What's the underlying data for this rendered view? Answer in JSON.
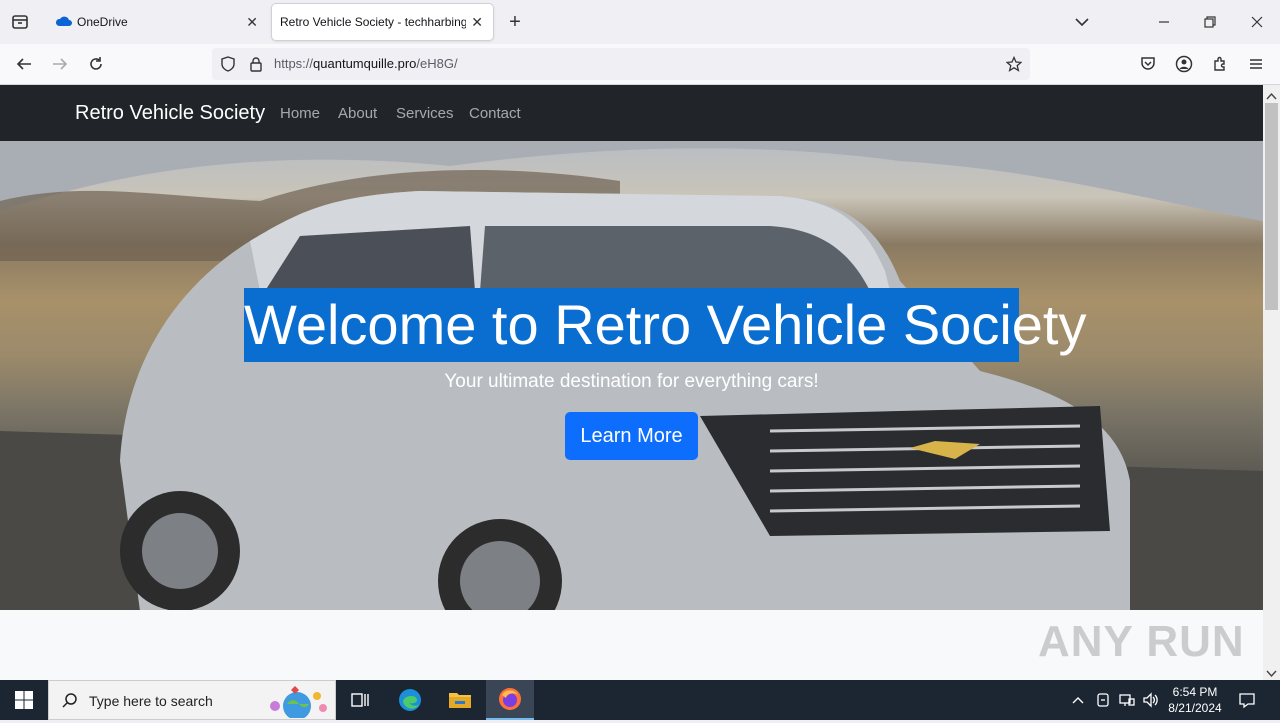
{
  "browser": {
    "tabs": [
      {
        "label": "OneDrive",
        "active": false
      },
      {
        "label": "Retro Vehicle Society - techharbinger",
        "active": true
      }
    ],
    "url": {
      "prefix": "https://",
      "host": "quantumquille.pro",
      "path": "/eH8G/"
    }
  },
  "site": {
    "brand": "Retro Vehicle Society",
    "nav": [
      "Home",
      "About",
      "Services",
      "Contact"
    ],
    "hero_title": "Welcome to Retro Vehicle Society",
    "hero_subtitle": "Your ultimate destination for everything cars!",
    "cta": "Learn More"
  },
  "watermark": "ANY RUN",
  "taskbar": {
    "search_placeholder": "Type here to search",
    "time": "6:54 PM",
    "date": "8/21/2024"
  },
  "colors": {
    "site_nav": "#212529",
    "cta": "#0d6efd",
    "title_highlight": "#0a6ed1"
  }
}
